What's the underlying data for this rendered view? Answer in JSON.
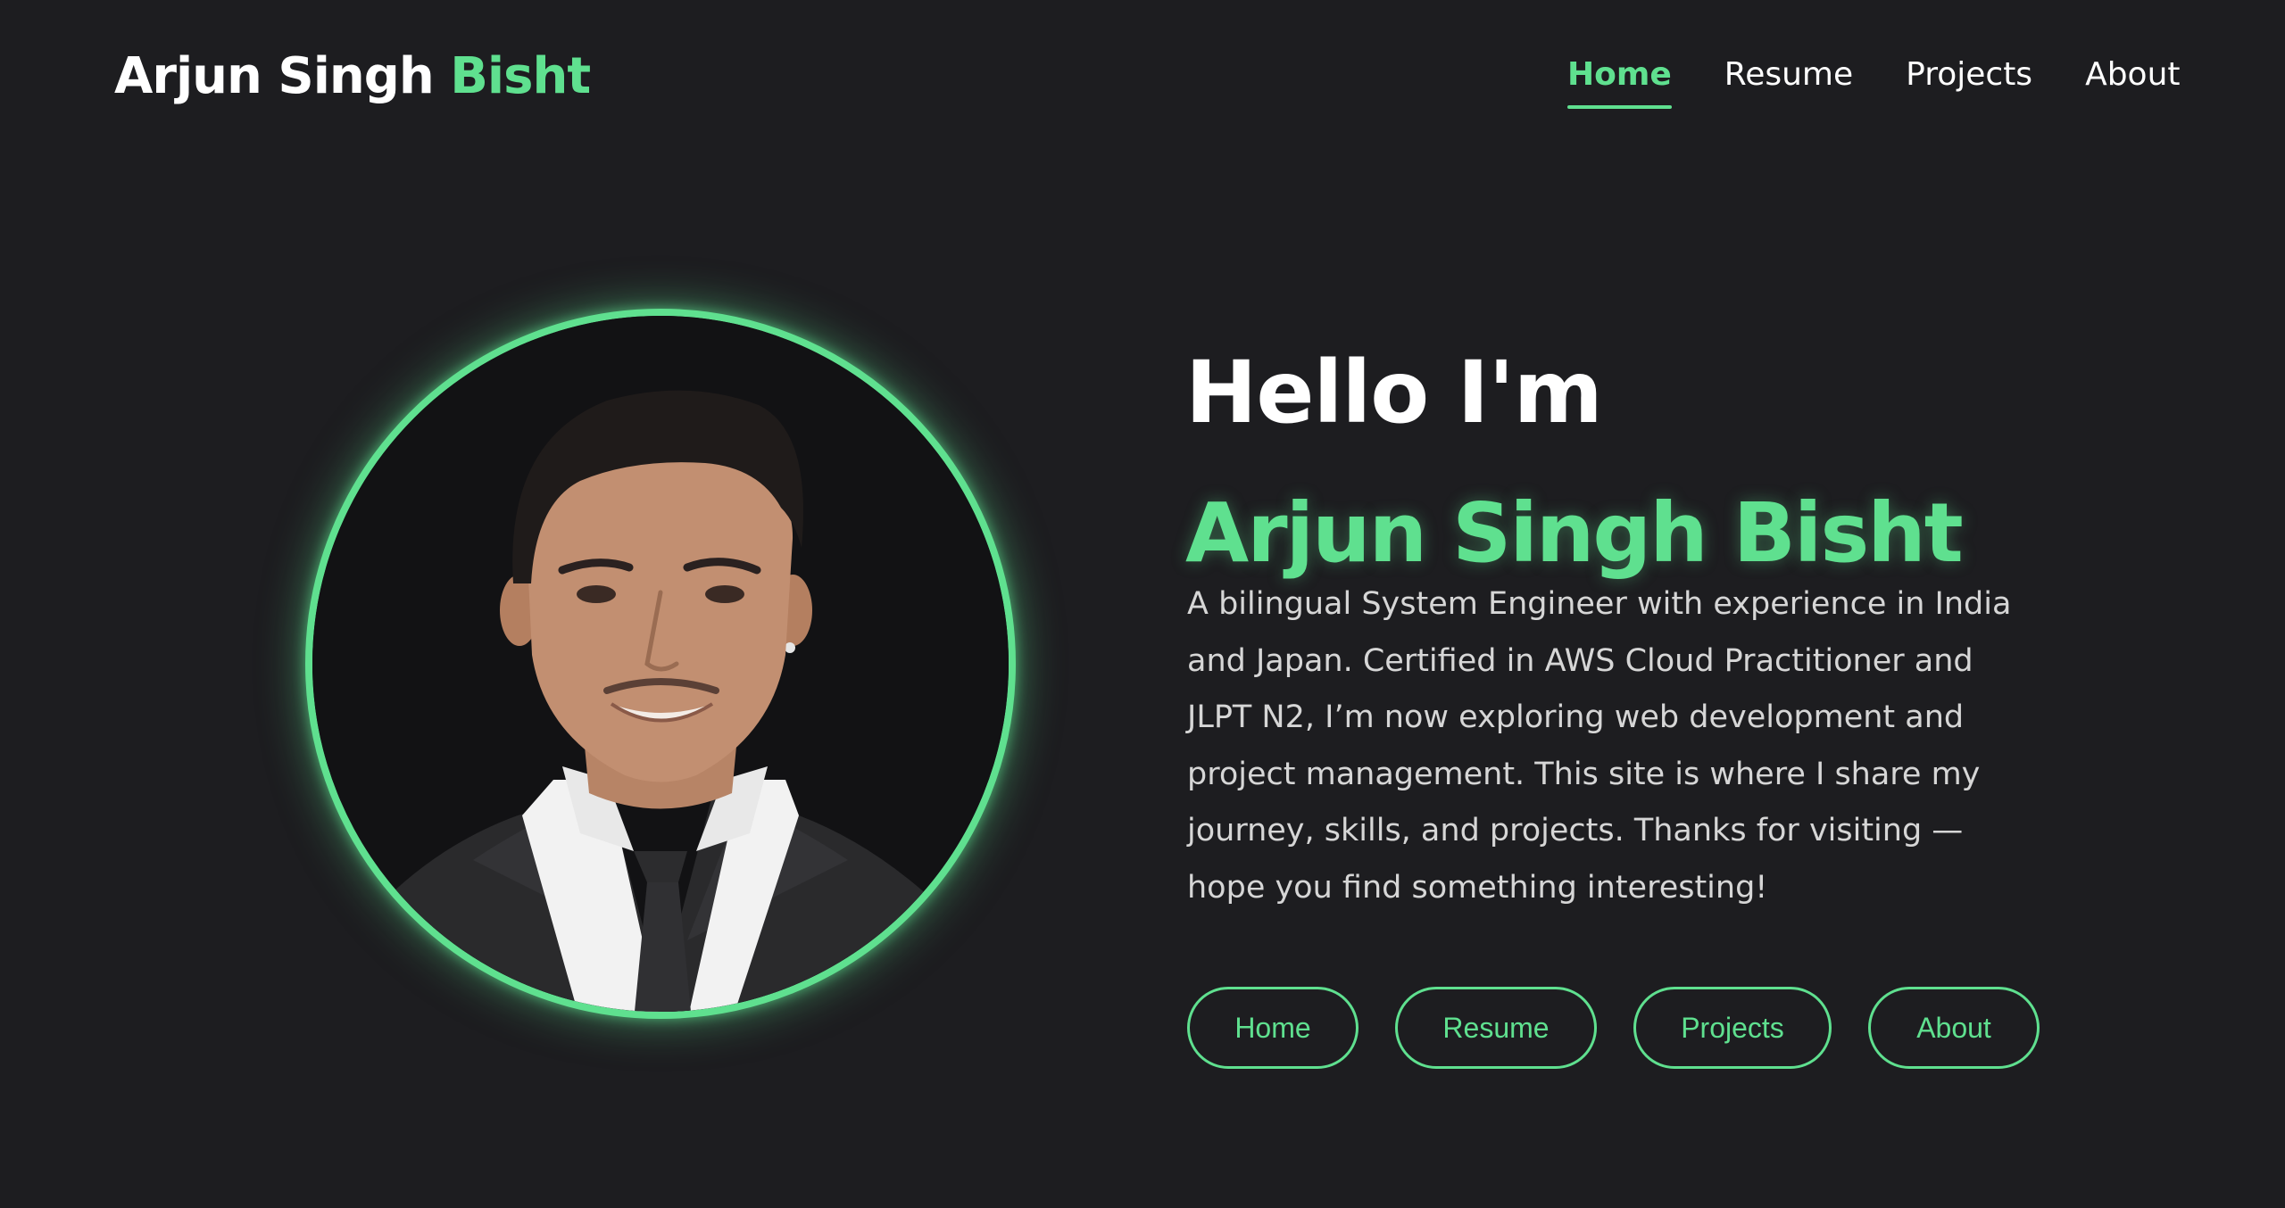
{
  "header": {
    "brand_first": "Arjun Singh",
    "brand_accent": "Bisht",
    "nav": [
      {
        "label": "Home",
        "active": true
      },
      {
        "label": "Resume",
        "active": false
      },
      {
        "label": "Projects",
        "active": false
      },
      {
        "label": "About",
        "active": false
      }
    ]
  },
  "hero": {
    "greeting": "Hello I'm",
    "name": "Arjun Singh Bisht",
    "bio": "A bilingual System Engineer with experience in India and Japan. Certified in AWS Cloud Practitioner and JLPT N2, I’m now exploring web development and project management. This site is where I share my journey, skills, and projects. Thanks for visiting — hope you find something interesting!",
    "buttons": [
      {
        "label": "Home"
      },
      {
        "label": "Resume"
      },
      {
        "label": "Projects"
      },
      {
        "label": "About"
      }
    ]
  },
  "colors": {
    "background": "#1d1d20",
    "accent": "#5fe08f",
    "text": "#ffffff",
    "body_text": "#d6d6d6"
  },
  "icons": {
    "profile_photo": "profile-photo"
  }
}
